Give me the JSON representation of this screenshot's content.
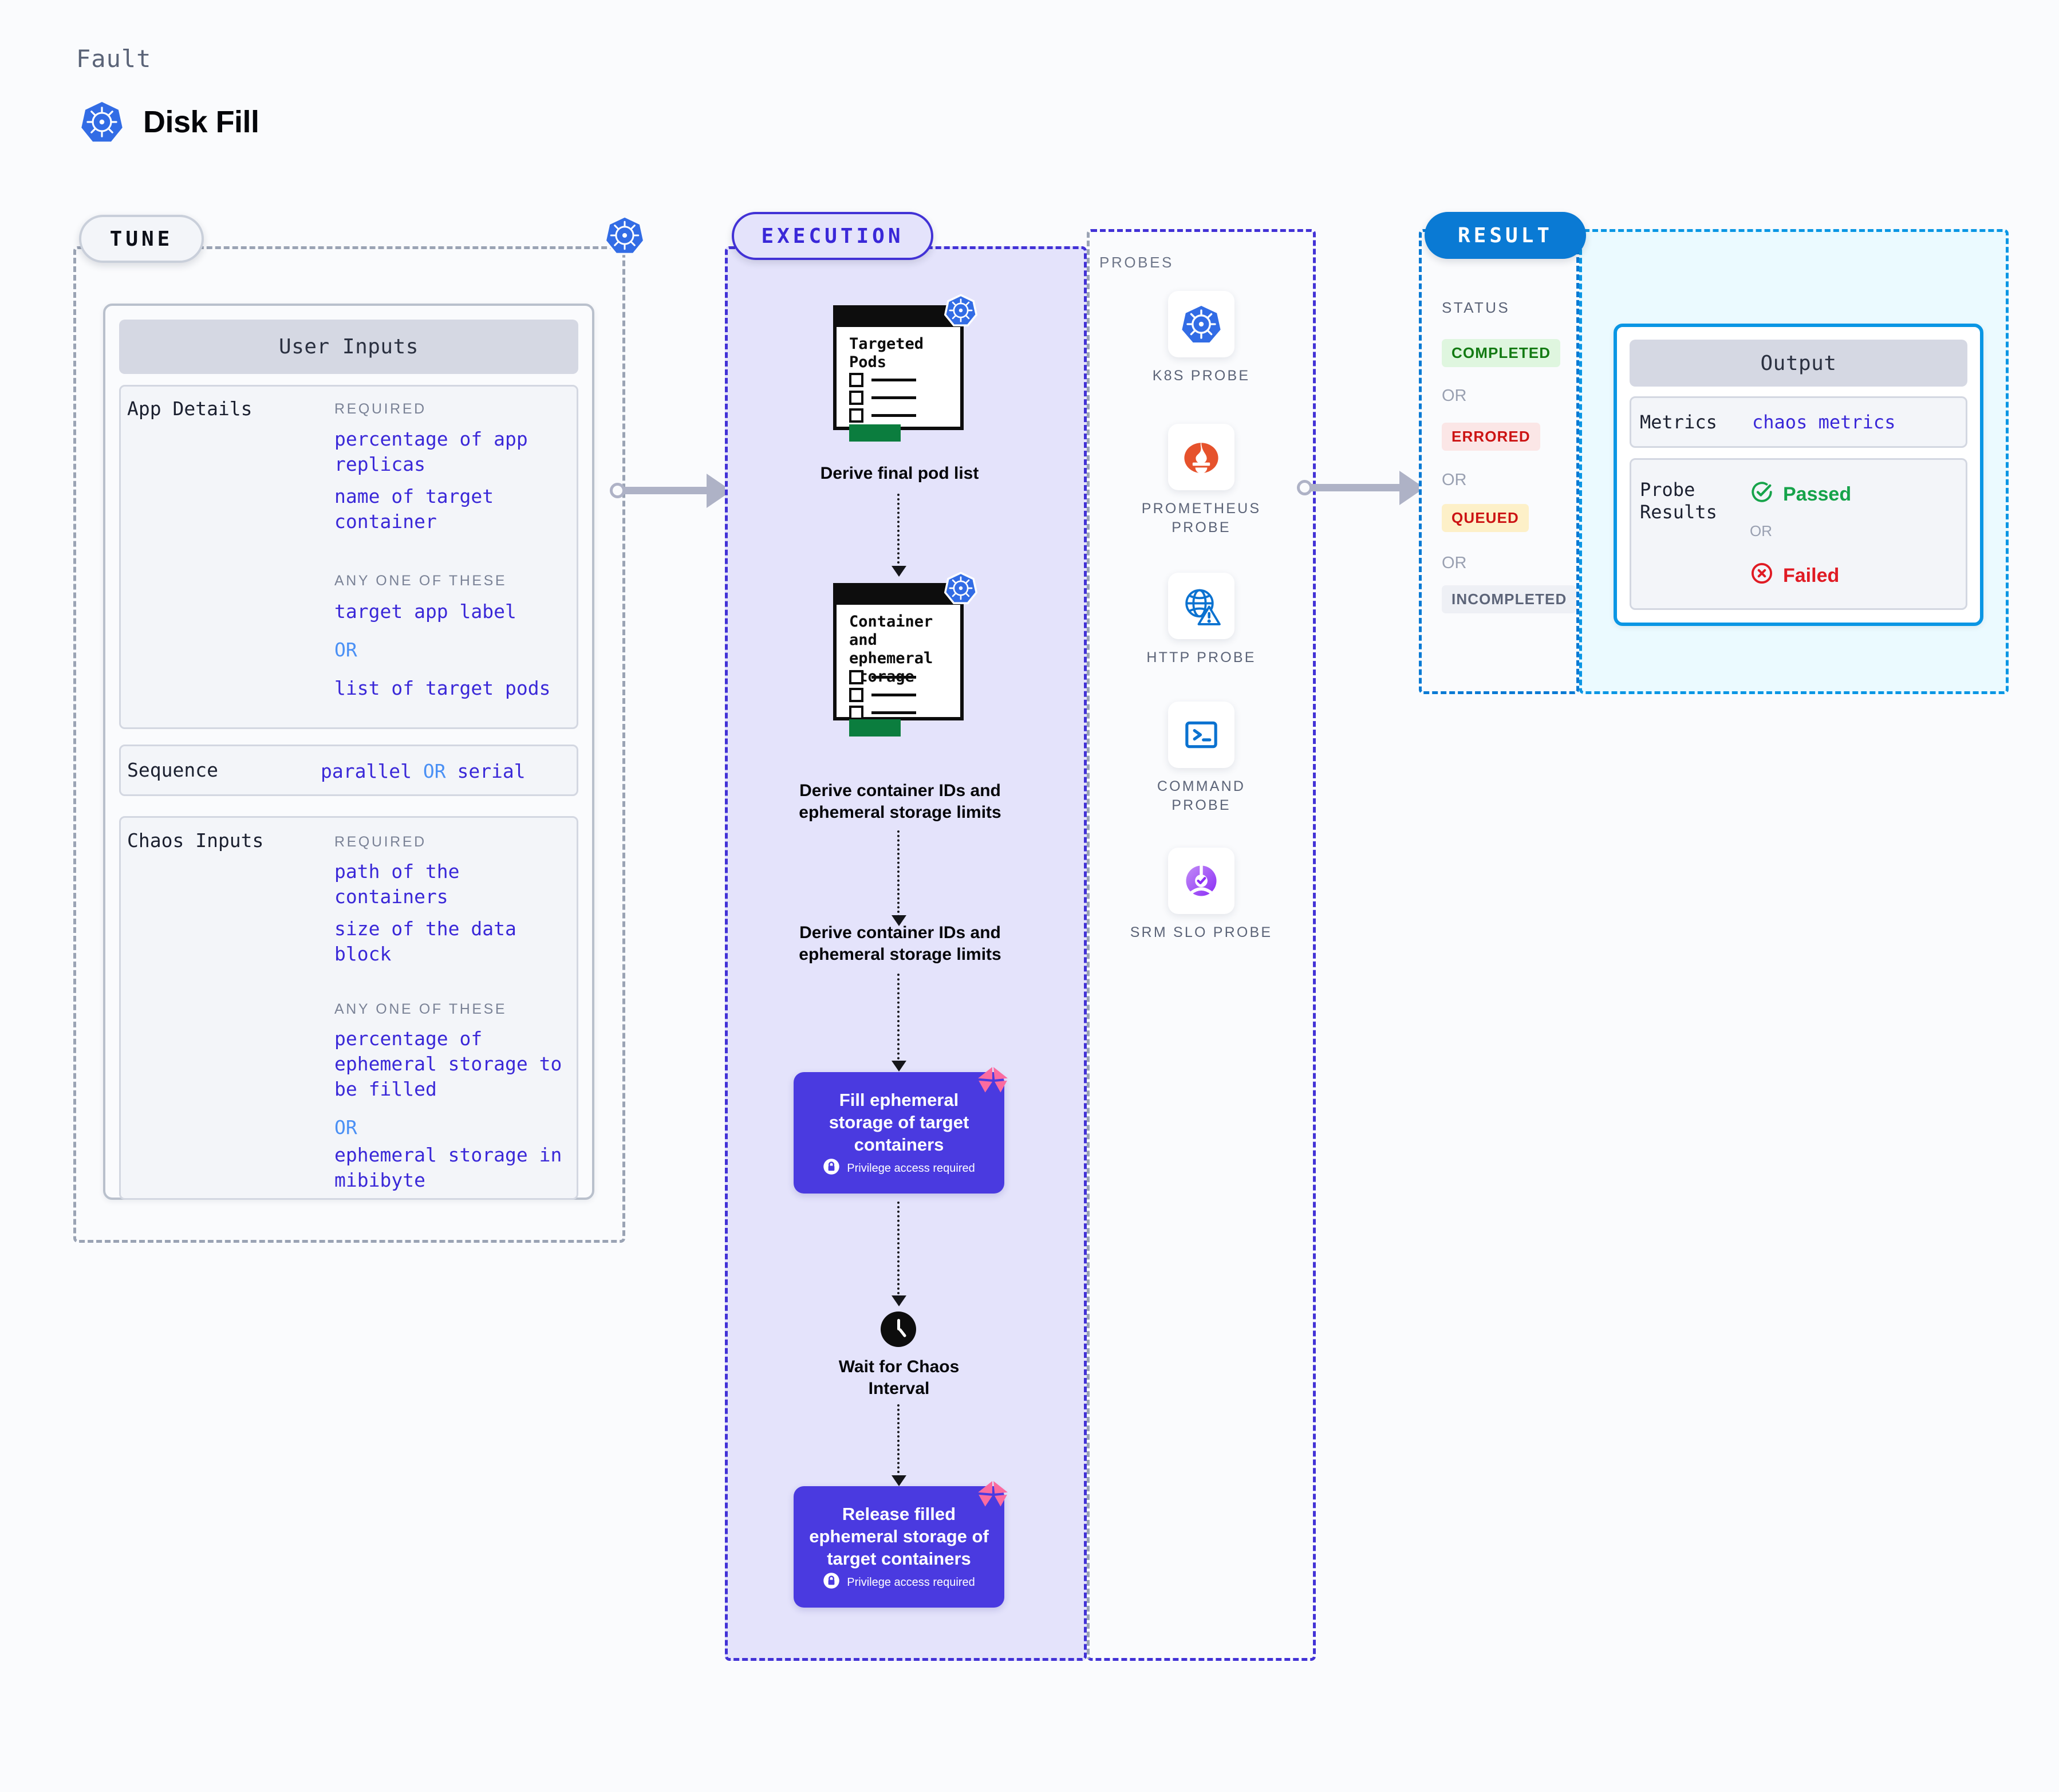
{
  "header": {
    "kicker": "Fault",
    "title": "Disk Fill",
    "logo_icon": "kubernetes-icon"
  },
  "tune": {
    "pill_label": "TUNE",
    "card_title": "User Inputs",
    "sections": [
      {
        "label": "App Details",
        "groups": [
          {
            "caption": "REQUIRED",
            "items": [
              "percentage of app replicas",
              "name of target container"
            ]
          },
          {
            "caption": "ANY ONE OF THESE",
            "items": [
              "target app label",
              "OR",
              "list of target pods"
            ]
          }
        ]
      }
    ],
    "sequence": {
      "label": "Sequence",
      "value_a": "parallel",
      "value_or": "OR",
      "value_b": "serial"
    },
    "chaos": {
      "label": "Chaos Inputs",
      "groups": [
        {
          "caption": "REQUIRED",
          "items": [
            "path of the containers",
            "size of the data block"
          ]
        },
        {
          "caption": "ANY ONE OF THESE",
          "items": [
            "percentage of ephemeral storage to be filled",
            "OR",
            "ephemeral storage in mibibyte"
          ]
        }
      ]
    }
  },
  "execution": {
    "pill_label": "EXECUTION",
    "nodes": [
      {
        "type": "doc",
        "doc_title": "Targeted Pods",
        "label": "Derive final pod list",
        "badge_icon": "kubernetes-icon"
      },
      {
        "type": "doc",
        "doc_title": "Container and ephemeral storage",
        "label": "Derive container IDs and ephemeral storage limits",
        "badge_icon": "kubernetes-icon"
      },
      {
        "type": "text",
        "label": "Derive container IDs and ephemeral storage limits"
      },
      {
        "type": "action",
        "label": "Fill ephemeral storage of target containers",
        "note": "Privilege access required",
        "note_icon": "lock-icon",
        "corner_icon": "harness-badge-icon"
      },
      {
        "type": "wait",
        "label": "Wait for Chaos Interval",
        "icon": "clock-icon"
      },
      {
        "type": "action",
        "label": "Release filled ephemeral storage of target containers",
        "note": "Privilege access required",
        "note_icon": "lock-icon",
        "corner_icon": "harness-badge-icon"
      }
    ]
  },
  "probes": {
    "title": "PROBES",
    "items": [
      {
        "name": "K8S PROBE",
        "icon": "kubernetes-icon"
      },
      {
        "name": "PROMETHEUS PROBE",
        "icon": "prometheus-icon"
      },
      {
        "name": "HTTP PROBE",
        "icon": "globe-warning-icon"
      },
      {
        "name": "COMMAND PROBE",
        "icon": "terminal-icon"
      },
      {
        "name": "SRM SLO PROBE",
        "icon": "srm-slo-icon"
      }
    ]
  },
  "result": {
    "pill_label": "RESULT",
    "status_title": "STATUS",
    "or_label": "OR",
    "statuses": [
      {
        "label": "COMPLETED",
        "tone": "completed"
      },
      {
        "label": "ERRORED",
        "tone": "errored"
      },
      {
        "label": "QUEUED",
        "tone": "queued"
      },
      {
        "label": "INCOMPLETED",
        "tone": "incompleted"
      }
    ],
    "output": {
      "title": "Output",
      "metrics_label": "Metrics",
      "metrics_value": "chaos metrics",
      "probe_label": "Probe Results",
      "passed": "Passed",
      "or_label": "OR",
      "failed": "Failed",
      "passed_icon": "check-circle-icon",
      "failed_icon": "x-circle-icon"
    }
  },
  "colors": {
    "accent_indigo": "#3a28d8",
    "accent_blue": "#4a90f5",
    "exec_bg": "#e4e3fb",
    "result_border": "#0a7ad4",
    "output_bg": "#ebfaff",
    "action_bg": "#4a3ae0",
    "k8s_blue": "#326ce5",
    "pass_green": "#16a34a",
    "fail_red": "#e01b24"
  }
}
